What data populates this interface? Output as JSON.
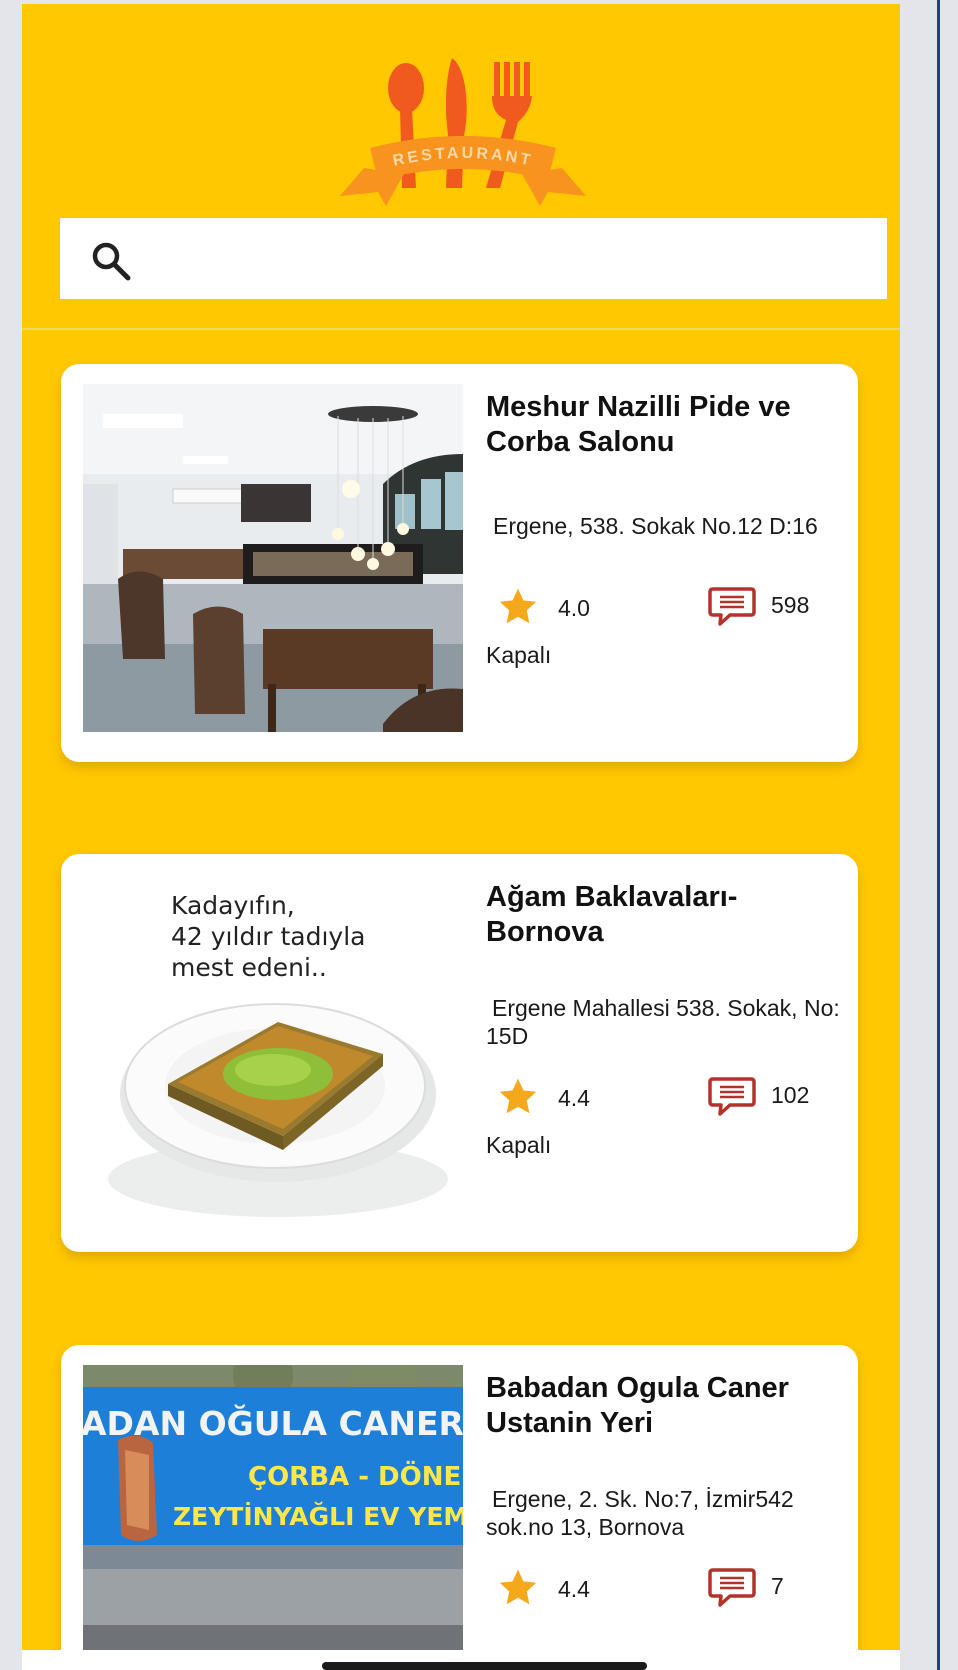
{
  "header": {
    "logo_text": "RESTAURANT",
    "logo_icon": "restaurant-logo-spoon-knife-fork"
  },
  "search": {
    "icon": "search-icon",
    "placeholder": "",
    "value": ""
  },
  "restaurants": [
    {
      "name": "Meshur Nazilli Pide ve Corba Salonu",
      "address": "Ergene, 538. Sokak No.12 D:16",
      "rating": "4.0",
      "reviews": "598",
      "status": "Kapalı"
    },
    {
      "name": "Ağam Baklavaları-Bornova",
      "address": "Ergene Mahallesi 538. Sokak, No: 15D",
      "rating": "4.4",
      "reviews": "102",
      "status": "Kapalı",
      "image_text": "Kadayıfın,\n42 yıldır tadıyla\nmest edeni.."
    },
    {
      "name": "Babadan Ogula Caner Ustanin Yeri",
      "address": "Ergene, 2. Sk. No:7, İzmir542 sok.no 13, Bornova",
      "rating": "4.4",
      "reviews": "7",
      "sign_text": [
        "ADAN OĞULA CANER U",
        "ÇORBA - DÖNER",
        "ZEYTİNYAĞLI EV YEMEKL"
      ]
    }
  ],
  "colors": {
    "background": "#ffc800",
    "card": "#ffffff",
    "star": "#f5a81c",
    "comment_icon": "#b3332a",
    "logo": "#f05a1e"
  }
}
